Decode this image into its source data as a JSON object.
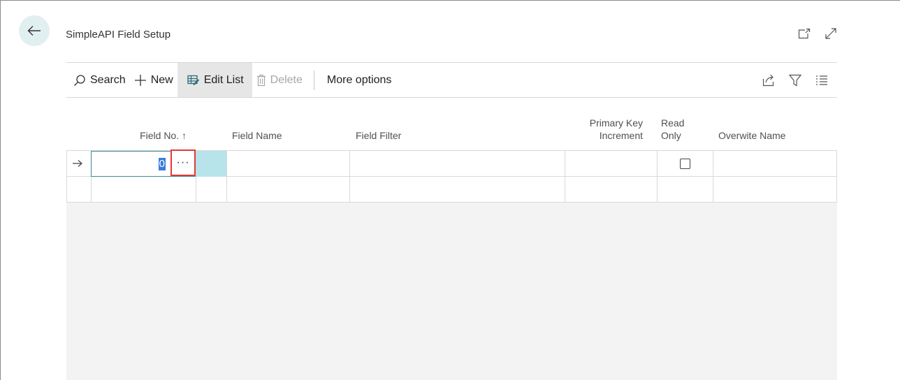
{
  "page": {
    "title": "SimpleAPI Field Setup"
  },
  "toolbar": {
    "search_label": "Search",
    "new_label": "New",
    "edit_list_label": "Edit List",
    "delete_label": "Delete",
    "more_options_label": "More options"
  },
  "grid": {
    "columns": [
      {
        "key": "field_no",
        "label": "Field No. ↑"
      },
      {
        "key": "field_name",
        "label": "Field Name"
      },
      {
        "key": "field_filter",
        "label": "Field Filter"
      },
      {
        "key": "pk_increment",
        "label_line1": "Primary Key",
        "label_line2": "Increment"
      },
      {
        "key": "read_only",
        "label_line1": "Read",
        "label_line2": "Only"
      },
      {
        "key": "overwrite_name",
        "label": "Overwite Name"
      }
    ],
    "rows": [
      {
        "field_no": "0",
        "read_only": false
      },
      {}
    ],
    "assist_button_label": "···"
  },
  "icons": {
    "back": "back-arrow-icon",
    "open_new_window": "open-in-new-window-icon",
    "expand": "expand-icon",
    "search": "search-icon",
    "new": "plus-icon",
    "edit_list": "edit-list-icon",
    "delete": "trash-icon",
    "share": "share-icon",
    "filter": "filter-icon",
    "list_view": "list-view-icon",
    "row_indicator": "row-arrow-icon"
  },
  "colors": {
    "accent": "#3e8899",
    "selection": "#3a7be0",
    "highlight_border": "#e53935",
    "active_cell": "#b7e4ea"
  }
}
